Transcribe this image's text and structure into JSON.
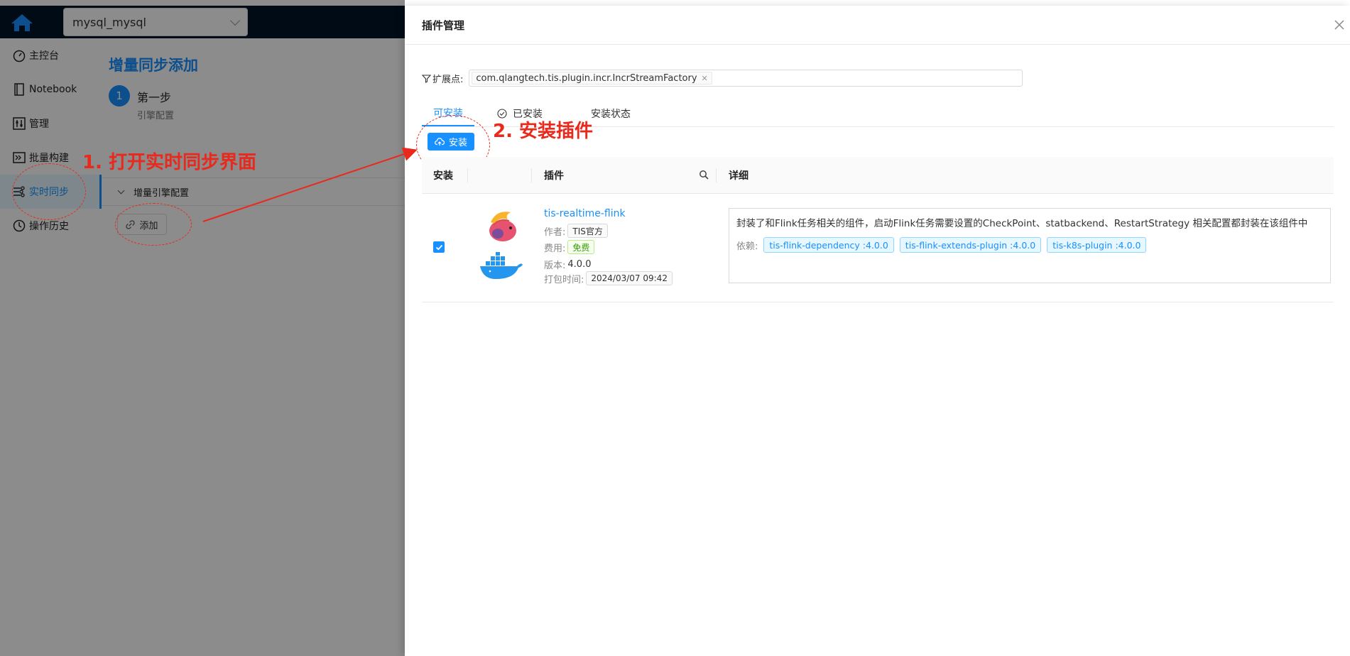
{
  "topbar": {
    "db_select_value": "mysql_mysql"
  },
  "sidebar": {
    "items": [
      {
        "label": "主控台",
        "icon": "dashboard-icon"
      },
      {
        "label": "Notebook",
        "icon": "notebook-icon"
      },
      {
        "label": "管理",
        "icon": "sliders-icon"
      },
      {
        "label": "批量构建",
        "icon": "terminal-icon"
      },
      {
        "label": "实时同步",
        "icon": "realtime-sync-icon"
      },
      {
        "label": "操作历史",
        "icon": "history-icon"
      }
    ]
  },
  "content": {
    "page_title": "增量同步添加",
    "step_number": "1",
    "step_title": "第一步",
    "step_subtitle": "引擎配置",
    "panel_header": "增量引擎配置",
    "add_button": "添加"
  },
  "annotations": {
    "step1": "1. 打开实时同步界面",
    "step2": "2. 安装插件"
  },
  "drawer": {
    "title": "插件管理",
    "ext_label": "扩展点:",
    "ext_tag": "com.qlangtech.tis.plugin.incr.IncrStreamFactory",
    "tabs": [
      {
        "label": "可安装",
        "active": true
      },
      {
        "label": "已安装",
        "active": false
      },
      {
        "label": "安装状态",
        "active": false
      }
    ],
    "install_button": "安装",
    "table": {
      "headers": {
        "install": "安装",
        "plugin": "插件",
        "detail": "详细"
      },
      "rows": [
        {
          "checked": true,
          "name": "tis-realtime-flink",
          "author_label": "作者:",
          "author": "TIS官方",
          "fee_label": "费用:",
          "fee": "免费",
          "version_label": "版本:",
          "version": "4.0.0",
          "pack_time_label": "打包时间:",
          "pack_time": "2024/03/07 09:42",
          "description": "封装了和Flink任务相关的组件，启动Flink任务需要设置的CheckPoint、statbackend、RestartStrategy 相关配置都封装在该组件中",
          "deps_label": "依赖:",
          "dependencies": [
            "tis-flink-dependency :4.0.0",
            "tis-flink-extends-plugin :4.0.0",
            "tis-k8s-plugin :4.0.0"
          ]
        }
      ]
    }
  },
  "colors": {
    "primary": "#1890ff",
    "annotation_red": "#e8291c",
    "header_dark": "#001529"
  }
}
